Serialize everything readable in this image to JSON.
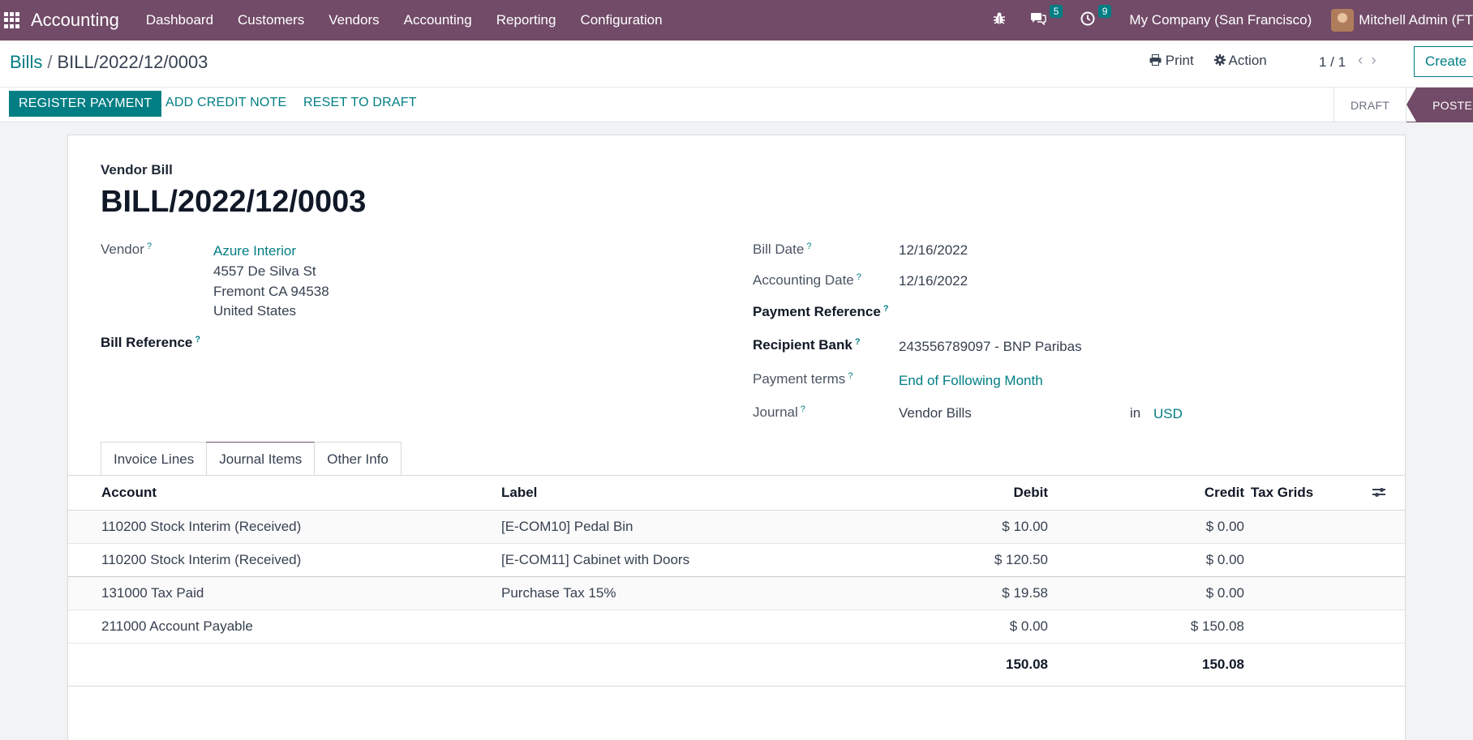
{
  "navbar": {
    "brand": "Accounting",
    "menu": [
      "Dashboard",
      "Customers",
      "Vendors",
      "Accounting",
      "Reporting",
      "Configuration"
    ],
    "messages_count": "5",
    "activities_count": "9",
    "company": "My Company (San Francisco)",
    "user": "Mitchell Admin (FT"
  },
  "control": {
    "breadcrumb_parent": "Bills",
    "breadcrumb_current": "BILL/2022/12/0003",
    "print_label": "Print",
    "action_label": "Action",
    "pager": "1 / 1",
    "create_label": "Create"
  },
  "statusbar": {
    "register_payment": "REGISTER PAYMENT",
    "add_credit_note": "ADD CREDIT NOTE",
    "reset_to_draft": "RESET TO DRAFT",
    "stages": [
      "DRAFT",
      "POSTED"
    ],
    "active_stage": "POSTED"
  },
  "form": {
    "doc_type": "Vendor Bill",
    "doc_name": "BILL/2022/12/0003",
    "vendor_label": "Vendor",
    "vendor_name": "Azure Interior",
    "vendor_address": [
      "4557 De Silva St",
      "Fremont CA 94538",
      "United States"
    ],
    "bill_reference_label": "Bill Reference",
    "bill_date_label": "Bill Date",
    "bill_date": "12/16/2022",
    "accounting_date_label": "Accounting Date",
    "accounting_date": "12/16/2022",
    "payment_reference_label": "Payment Reference",
    "recipient_bank_label": "Recipient Bank",
    "recipient_bank": "243556789097 - BNP Paribas",
    "payment_terms_label": "Payment terms",
    "payment_terms": "End of Following Month",
    "journal_label": "Journal",
    "journal": "Vendor Bills",
    "in_label": "in",
    "currency": "USD",
    "help_mark": "?"
  },
  "tabs": [
    "Invoice Lines",
    "Journal Items",
    "Other Info"
  ],
  "active_tab": "Journal Items",
  "journal_table": {
    "headers": {
      "account": "Account",
      "label": "Label",
      "debit": "Debit",
      "credit": "Credit",
      "tax_grids": "Tax Grids"
    },
    "rows": [
      {
        "account": "110200 Stock Interim (Received)",
        "label": "[E-COM10] Pedal Bin",
        "debit": "$ 10.00",
        "credit": "$ 0.00"
      },
      {
        "account": "110200 Stock Interim (Received)",
        "label": "[E-COM11] Cabinet with Doors",
        "debit": "$ 120.50",
        "credit": "$ 0.00"
      },
      {
        "account": "131000 Tax Paid",
        "label": "Purchase Tax 15%",
        "debit": "$ 19.58",
        "credit": "$ 0.00"
      },
      {
        "account": "211000 Account Payable",
        "label": "",
        "debit": "$ 0.00",
        "credit": "$ 150.08"
      }
    ],
    "total_debit": "150.08",
    "total_credit": "150.08"
  },
  "icons": {
    "apps": "apps-grid-icon",
    "debug": "bug-icon",
    "messages": "chat-icon",
    "activities": "clock-icon",
    "print": "printer-icon",
    "action": "gear-icon",
    "optional_columns": "sliders-icon"
  },
  "colors": {
    "brand": "#714b67",
    "accent": "#017e84"
  }
}
